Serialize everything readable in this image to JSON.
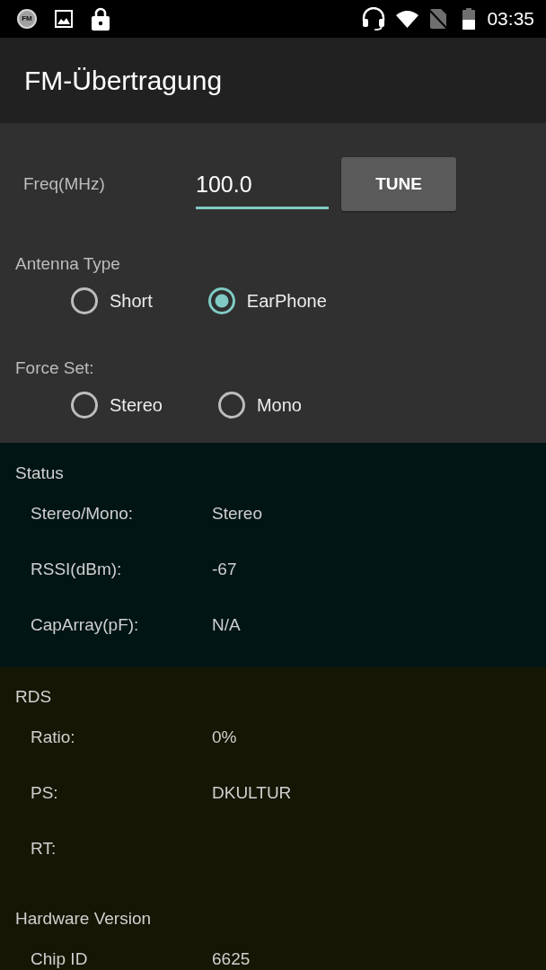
{
  "status_bar": {
    "badge": "FM",
    "time": "03:35"
  },
  "app_bar": {
    "title": "FM-Übertragung"
  },
  "tuner": {
    "label": "Freq(MHz)",
    "frequency": "100.0",
    "button": "TUNE"
  },
  "radio_groups": [
    {
      "label": "Antenna Type",
      "options": [
        {
          "label": "Short",
          "selected": false
        },
        {
          "label": "EarPhone",
          "selected": true
        }
      ]
    },
    {
      "label": "Force Set:",
      "options": [
        {
          "label": "Stereo",
          "selected": false
        },
        {
          "label": "Mono",
          "selected": false
        }
      ]
    }
  ],
  "panels": [
    {
      "color": "#021515",
      "groups": [
        {
          "title": "Status",
          "rows": [
            {
              "label": "Stereo/Mono:",
              "value": "Stereo"
            },
            {
              "label": "RSSI(dBm):",
              "value": "-67"
            },
            {
              "label": "CapArray(pF):",
              "value": "N/A"
            }
          ]
        }
      ]
    },
    {
      "color": "#161604",
      "groups": [
        {
          "title": "RDS",
          "rows": [
            {
              "label": "Ratio:",
              "value": "0%"
            },
            {
              "label": "PS:",
              "value": "DKULTUR"
            },
            {
              "label": "RT:"
            }
          ]
        },
        {
          "title": "Hardware Version",
          "rows": [
            {
              "label": "Chip ID",
              "value": "6625"
            }
          ]
        }
      ]
    }
  ]
}
